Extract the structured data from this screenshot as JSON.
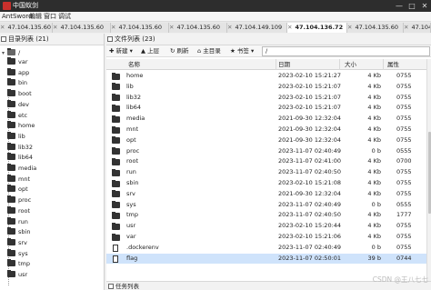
{
  "window": {
    "title": "中国蚁剑",
    "min": "—",
    "max": "□",
    "close": "✕"
  },
  "menu": [
    "AntSword",
    "编辑",
    "窗口",
    "调试"
  ],
  "tabs": [
    {
      "label": "47.104.135.60",
      "close": "✕",
      "active": false
    },
    {
      "label": "47.104.135.60",
      "close": "✕",
      "active": false
    },
    {
      "label": "47.104.135.60",
      "close": "✕",
      "active": false
    },
    {
      "label": "47.104.135.60",
      "close": "✕",
      "active": false
    },
    {
      "label": "47.104.149.109",
      "close": "✕",
      "active": false
    },
    {
      "label": "47.104.136.72",
      "close": "✕",
      "active": true
    },
    {
      "label": "47.104.135.60",
      "close": "✕",
      "active": false
    },
    {
      "label": "47.104.135.60",
      "close": "✕",
      "active": false
    }
  ],
  "dir_panel": {
    "title": "目录列表 (21)",
    "root": "/",
    "items": [
      "var",
      "app",
      "bin",
      "boot",
      "dev",
      "etc",
      "home",
      "lib",
      "lib32",
      "lib64",
      "media",
      "mnt",
      "opt",
      "proc",
      "root",
      "run",
      "sbin",
      "srv",
      "sys",
      "tmp",
      "usr"
    ]
  },
  "file_panel": {
    "title": "文件列表 (23)",
    "toolbar": {
      "new": "新建",
      "up": "上层",
      "refresh": "刷新",
      "home": "主目录",
      "bookmark": "书签"
    },
    "path": "/",
    "columns": {
      "name": "名称",
      "date": "日期",
      "size": "大小",
      "perm": "属性"
    },
    "rows": [
      {
        "name": "home",
        "date": "2023-02-10 15:21:27",
        "size": "4 Kb",
        "perm": "0755",
        "type": "folder"
      },
      {
        "name": "lib",
        "date": "2023-02-10 15:21:07",
        "size": "4 Kb",
        "perm": "0755",
        "type": "folder"
      },
      {
        "name": "lib32",
        "date": "2023-02-10 15:21:07",
        "size": "4 Kb",
        "perm": "0755",
        "type": "folder"
      },
      {
        "name": "lib64",
        "date": "2023-02-10 15:21:07",
        "size": "4 Kb",
        "perm": "0755",
        "type": "folder"
      },
      {
        "name": "media",
        "date": "2021-09-30 12:32:04",
        "size": "4 Kb",
        "perm": "0755",
        "type": "folder"
      },
      {
        "name": "mnt",
        "date": "2021-09-30 12:32:04",
        "size": "4 Kb",
        "perm": "0755",
        "type": "folder"
      },
      {
        "name": "opt",
        "date": "2021-09-30 12:32:04",
        "size": "4 Kb",
        "perm": "0755",
        "type": "folder"
      },
      {
        "name": "proc",
        "date": "2023-11-07 02:40:49",
        "size": "0 b",
        "perm": "0555",
        "type": "folder"
      },
      {
        "name": "root",
        "date": "2023-11-07 02:41:00",
        "size": "4 Kb",
        "perm": "0700",
        "type": "folder"
      },
      {
        "name": "run",
        "date": "2023-11-07 02:40:50",
        "size": "4 Kb",
        "perm": "0755",
        "type": "folder"
      },
      {
        "name": "sbin",
        "date": "2023-02-10 15:21:08",
        "size": "4 Kb",
        "perm": "0755",
        "type": "folder"
      },
      {
        "name": "srv",
        "date": "2021-09-30 12:32:04",
        "size": "4 Kb",
        "perm": "0755",
        "type": "folder"
      },
      {
        "name": "sys",
        "date": "2023-11-07 02:40:49",
        "size": "0 b",
        "perm": "0555",
        "type": "folder"
      },
      {
        "name": "tmp",
        "date": "2023-11-07 02:40:50",
        "size": "4 Kb",
        "perm": "1777",
        "type": "folder"
      },
      {
        "name": "usr",
        "date": "2023-02-10 15:20:44",
        "size": "4 Kb",
        "perm": "0755",
        "type": "folder"
      },
      {
        "name": "var",
        "date": "2023-02-10 15:21:06",
        "size": "4 Kb",
        "perm": "0755",
        "type": "folder"
      },
      {
        "name": ".dockerenv",
        "date": "2023-11-07 02:40:49",
        "size": "0 b",
        "perm": "0755",
        "type": "file"
      },
      {
        "name": "flag",
        "date": "2023-11-07 02:50:01",
        "size": "39 b",
        "perm": "0744",
        "type": "file",
        "selected": true
      }
    ]
  },
  "task_panel": {
    "title": "任务列表"
  },
  "watermark": "CSDN @王八七七"
}
